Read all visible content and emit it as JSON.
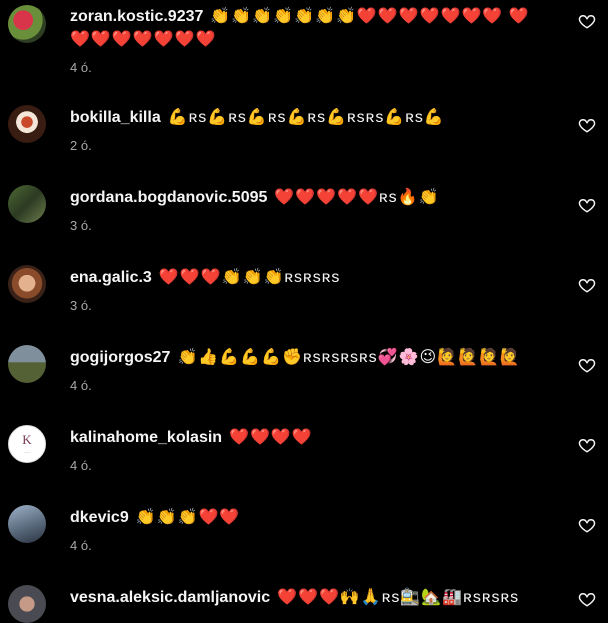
{
  "comments": [
    {
      "username": "zoran.kostic.9237",
      "text": "👏👏👏👏👏👏👏❤️❤️❤️❤️❤️❤️❤️ ❤️❤️❤️❤️❤️❤️❤️❤️",
      "time": "4 ó."
    },
    {
      "username": "bokilla_killa",
      "text": "💪ʀs💪ʀs💪ʀs💪ʀs💪ʀsʀs💪ʀs💪",
      "time": "2 ó."
    },
    {
      "username": "gordana.bogdanovic.5095",
      "text": "❤️❤️❤️❤️❤️ʀs🔥👏",
      "time": "3 ó."
    },
    {
      "username": "ena.galic.3",
      "text": "❤️❤️❤️👏👏👏ʀsʀsʀs",
      "time": "3 ó."
    },
    {
      "username": "gogijorgos27",
      "text": "👏👍💪💪💪✊ʀsʀsʀsʀs💞🌸😉🙋🙋🙋🙋",
      "time": "4 ó."
    },
    {
      "username": "kalinahome_kolasin",
      "text": "❤️❤️❤️❤️",
      "time": "4 ó.",
      "avatar_text": "K"
    },
    {
      "username": "dkevic9",
      "text": "👏👏👏❤️❤️",
      "time": "4 ó."
    },
    {
      "username": "vesna.aleksic.damljanovic",
      "text": "❤️❤️❤️🙌🙏ʀs🚉🏡🏭ʀsʀsʀs",
      "time": ""
    }
  ]
}
